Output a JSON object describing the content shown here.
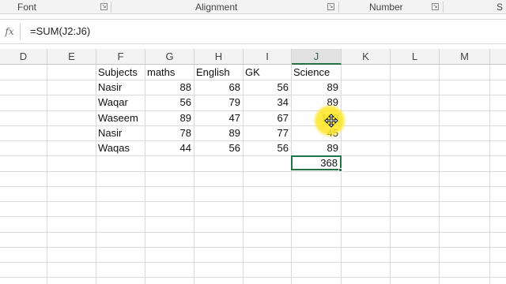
{
  "ribbon": {
    "groups": [
      {
        "label": "Font"
      },
      {
        "label": "Alignment"
      },
      {
        "label": "Number"
      },
      {
        "label": "S"
      }
    ]
  },
  "formula_bar": {
    "fx_label": "fx",
    "formula": "=SUM(J2:J6)"
  },
  "sheet": {
    "column_headers": [
      "D",
      "E",
      "F",
      "G",
      "H",
      "I",
      "J",
      "K",
      "L",
      "M"
    ],
    "active_column": "J",
    "header_row": [
      "Subjects",
      "maths",
      "English",
      "GK",
      "Science"
    ],
    "rows": [
      [
        "Nasir",
        "88",
        "68",
        "56",
        "89"
      ],
      [
        "Waqar",
        "56",
        "79",
        "34",
        "89"
      ],
      [
        "Waseem",
        "89",
        "47",
        "67",
        "100"
      ],
      [
        "Nasir",
        "78",
        "89",
        "77",
        "45"
      ],
      [
        "Waqas",
        "44",
        "56",
        "56",
        "89"
      ]
    ],
    "total": "368",
    "selected_cell": "J7"
  },
  "colors": {
    "accent": "#217346",
    "cursor_highlight": "#ffe628"
  }
}
